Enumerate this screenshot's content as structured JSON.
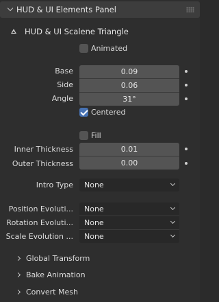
{
  "panel": {
    "title": "HUD & UI Elements Panel"
  },
  "subpanel": {
    "title": "HUD & UI Scalene Triangle"
  },
  "animated": {
    "label": "Animated",
    "checked": false
  },
  "base": {
    "label": "Base",
    "value": "0.09"
  },
  "side": {
    "label": "Side",
    "value": "0.06"
  },
  "angle": {
    "label": "Angle",
    "value": "31°"
  },
  "centered": {
    "label": "Centered",
    "checked": true
  },
  "fill": {
    "label": "Fill",
    "checked": false
  },
  "inner_thickness": {
    "label": "Inner Thickness",
    "value": "0.01"
  },
  "outer_thickness": {
    "label": "Outer Thickness",
    "value": "0.00"
  },
  "intro_type": {
    "label": "Intro Type",
    "value": "None"
  },
  "position_evolution": {
    "label": "Position Evoluti...",
    "value": "None"
  },
  "rotation_evolution": {
    "label": "Rotation Evoluti...",
    "value": "None"
  },
  "scale_evolution": {
    "label": "Scale Evolution ...",
    "value": "None"
  },
  "sections": {
    "global_transform": "Global Transform",
    "bake_animation": "Bake Animation",
    "convert_mesh": "Convert Mesh"
  },
  "colors": {
    "accent": "#4772b3",
    "field": "#545454",
    "dropdown": "#282828",
    "panel": "#2e2e2e",
    "header": "#3d3d3d"
  }
}
